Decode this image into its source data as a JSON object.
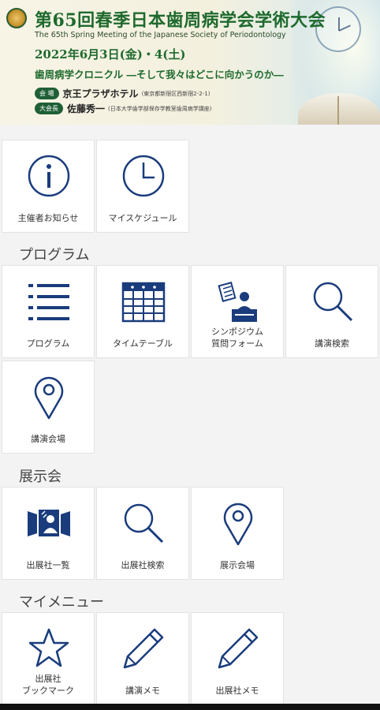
{
  "banner": {
    "title": "第65回春季日本歯周病学会学術大会",
    "subtitle": "The 65th Spring Meeting of the Japanese Society of Periodontology",
    "date": "2022年6月3日(金)・4(土)",
    "theme": "歯周病学クロニクル ―そして我々はどこに向かうのか―",
    "venue_label": "会 場",
    "venue": "京王プラザホテル",
    "venue_note": "(東京都新宿区西新宿2-2-1)",
    "chair_label": "大会長",
    "chair": "佐藤秀一",
    "chair_note": "(日本大学歯学部保存学教室歯周病学講座)"
  },
  "sections": {
    "program": "プログラム",
    "exhibition": "展示会",
    "mymenu": "マイメニュー"
  },
  "tiles": {
    "notice": "主催者お知らせ",
    "myschedule": "マイスケジュール",
    "program": "プログラム",
    "timetable": "タイムテーブル",
    "symposium": "シンポジウム\n質問フォーム",
    "lecture_search": "講演検索",
    "lecture_venue": "講演会場",
    "exhibitors": "出展社一覧",
    "exhibitor_search": "出展社検索",
    "exhibit_venue": "展示会場",
    "bookmark": "出展社\nブックマーク",
    "lecture_memo": "講演メモ",
    "exhibitor_memo": "出展社メモ"
  },
  "icons": {
    "notice": "info-icon",
    "myschedule": "clock-icon",
    "program": "list-icon",
    "timetable": "calendar-grid-icon",
    "symposium": "lecturer-podium-icon",
    "lecture_search": "search-icon",
    "lecture_venue": "map-pin-icon",
    "exhibitors": "exhibit-booth-icon",
    "exhibitor_search": "search-icon",
    "exhibit_venue": "map-pin-icon",
    "bookmark": "star-icon",
    "lecture_memo": "pencil-icon",
    "exhibitor_memo": "pencil-icon"
  },
  "colors": {
    "icon": "#1a3c7c",
    "banner_green": "#1e6a2e",
    "background": "#f3f3f3"
  }
}
